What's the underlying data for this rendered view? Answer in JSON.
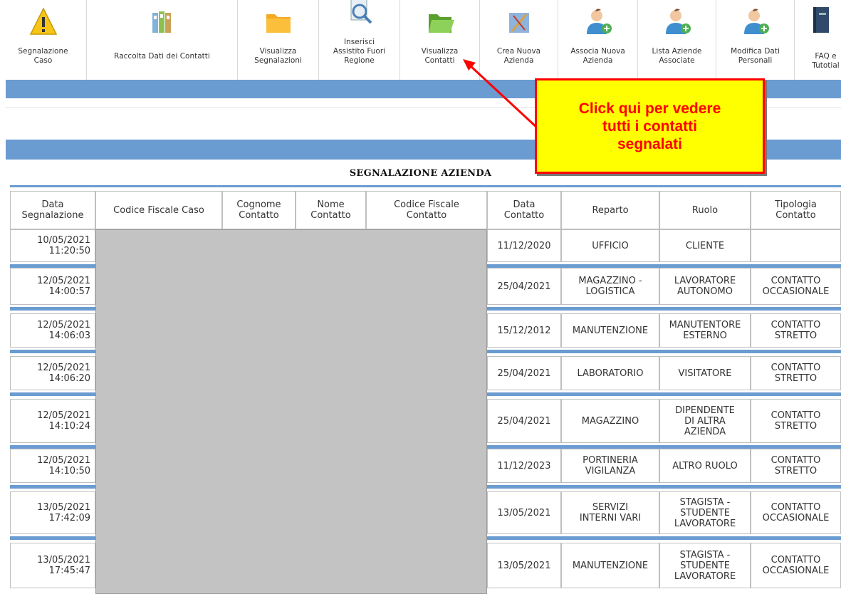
{
  "toolbar": {
    "items": [
      {
        "label": "Segnalazione\nCaso",
        "icon": "warning-icon"
      },
      {
        "label": "Raccolta Dati dei Contatti",
        "icon": "binders-icon"
      },
      {
        "label": "Visualizza\nSegnalazioni",
        "icon": "folder-icon"
      },
      {
        "label": "Inserisci\nAssistito Fuori\nRegione",
        "icon": "magnifier-document-icon"
      },
      {
        "label": "Visualizza\nContatti",
        "icon": "open-folder-icon"
      },
      {
        "label": "Crea Nuova\nAzienda",
        "icon": "drafting-icon"
      },
      {
        "label": "Associa Nuova\nAzienda",
        "icon": "user-add-icon"
      },
      {
        "label": "Lista Aziende\nAssociate",
        "icon": "user-add-icon"
      },
      {
        "label": "Modifica Dati\nPersonali",
        "icon": "user-add-icon"
      },
      {
        "label": "FAQ e\nTutotial",
        "icon": "book-icon"
      }
    ]
  },
  "section_title": "SEGNALAZIONE AZIENDA",
  "table": {
    "headers": [
      "Data\nSegnalazione",
      "Codice Fiscale Caso",
      "Cognome\nContatto",
      "Nome\nContatto",
      "Codice Fiscale\nContatto",
      "Data\nContatto",
      "Reparto",
      "Ruolo",
      "Tipologia\nContatto"
    ],
    "rows": [
      {
        "data_segnalazione": "10/05/2021\n11:20:50",
        "data_contatto": "11/12/2020",
        "reparto": "UFFICIO",
        "ruolo": "CLIENTE",
        "tipologia": ""
      },
      {
        "data_segnalazione": "12/05/2021\n14:00:57",
        "data_contatto": "25/04/2021",
        "reparto": "MAGAZZINO -\nLOGISTICA",
        "ruolo": "LAVORATORE\nAUTONOMO",
        "tipologia": "CONTATTO\nOCCASIONALE"
      },
      {
        "data_segnalazione": "12/05/2021\n14:06:03",
        "data_contatto": "15/12/2012",
        "reparto": "MANUTENZIONE",
        "ruolo": "MANUTENTORE\nESTERNO",
        "tipologia": "CONTATTO\nSTRETTO"
      },
      {
        "data_segnalazione": "12/05/2021\n14:06:20",
        "data_contatto": "25/04/2021",
        "reparto": "LABORATORIO",
        "ruolo": "VISITATORE",
        "tipologia": "CONTATTO\nSTRETTO"
      },
      {
        "data_segnalazione": "12/05/2021\n14:10:24",
        "data_contatto": "25/04/2021",
        "reparto": "MAGAZZINO",
        "ruolo": "DIPENDENTE\nDI ALTRA\nAZIENDA",
        "tipologia": "CONTATTO\nSTRETTO"
      },
      {
        "data_segnalazione": "12/05/2021\n14:10:50",
        "data_contatto": "11/12/2023",
        "reparto": "PORTINERIA\nVIGILANZA",
        "ruolo": "ALTRO RUOLO",
        "tipologia": "CONTATTO\nSTRETTO"
      },
      {
        "data_segnalazione": "13/05/2021\n17:42:09",
        "data_contatto": "13/05/2021",
        "reparto": "SERVIZI\nINTERNI VARI",
        "ruolo": "STAGISTA -\nSTUDENTE\nLAVORATORE",
        "tipologia": "CONTATTO\nOCCASIONALE"
      },
      {
        "data_segnalazione": "13/05/2021\n17:45:47",
        "data_contatto": "13/05/2021",
        "reparto": "MANUTENZIONE",
        "ruolo": "STAGISTA -\nSTUDENTE\nLAVORATORE",
        "tipologia": "CONTATTO\nOCCASIONALE"
      }
    ]
  },
  "callout": {
    "text": "Click qui per vedere\ntutti i contatti\nsegnalati"
  },
  "colors": {
    "accent_bar": "#6a9bd1",
    "callout_bg": "#ffff00",
    "callout_text": "#ff0000"
  }
}
